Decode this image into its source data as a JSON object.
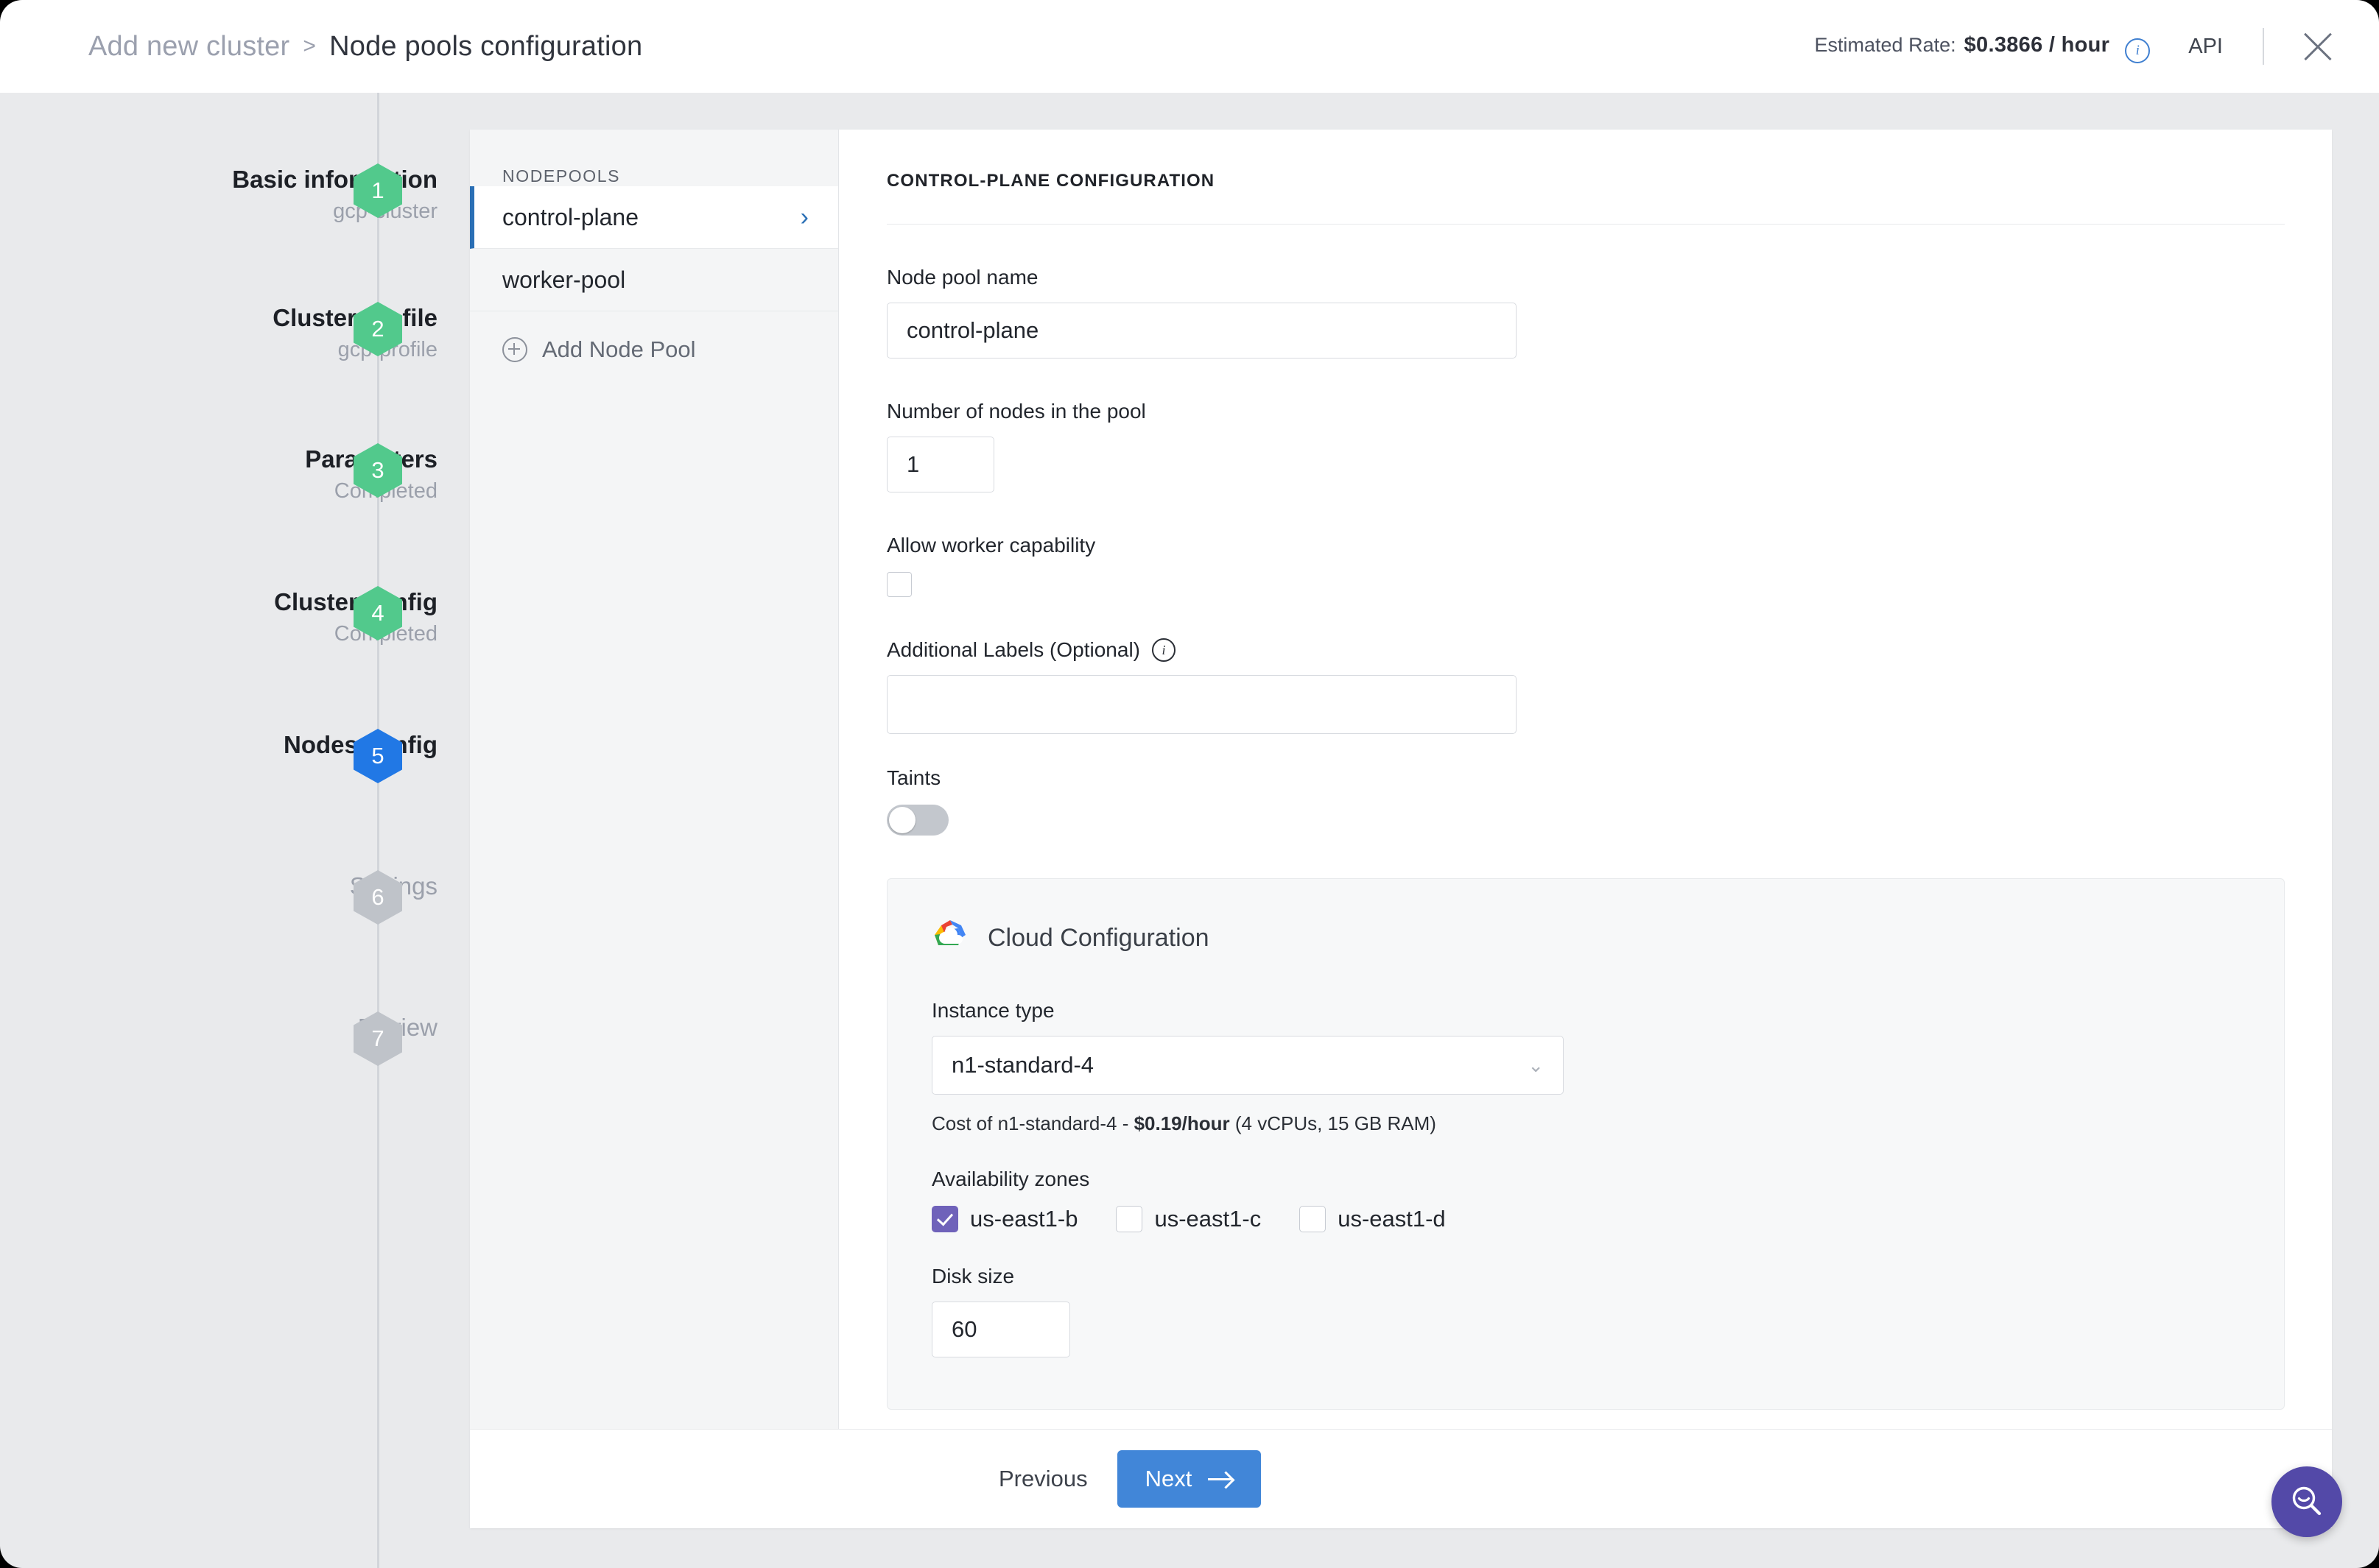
{
  "header": {
    "breadcrumb_parent": "Add new cluster",
    "breadcrumb_separator": ">",
    "breadcrumb_current": "Node pools configuration",
    "rate_label": "Estimated Rate:",
    "rate_value": "$0.3866 / hour",
    "rate_info_icon": "info-icon",
    "api_link": "API",
    "close_icon": "close-icon"
  },
  "stepper": {
    "steps": [
      {
        "num": "1",
        "title": "Basic information",
        "sub": "gcp-cluster",
        "state": "done"
      },
      {
        "num": "2",
        "title": "Cluster profile",
        "sub": "gcp-profile",
        "state": "done"
      },
      {
        "num": "3",
        "title": "Parameters",
        "sub": "Completed",
        "state": "done"
      },
      {
        "num": "4",
        "title": "Cluster config",
        "sub": "Completed",
        "state": "done"
      },
      {
        "num": "5",
        "title": "Nodes config",
        "sub": "",
        "state": "current"
      },
      {
        "num": "6",
        "title": "Settings",
        "sub": "",
        "state": "pending"
      },
      {
        "num": "7",
        "title": "Review",
        "sub": "",
        "state": "pending"
      }
    ]
  },
  "nodepools": {
    "panel_header": "NODEPOOLS",
    "items": [
      {
        "label": "control-plane",
        "selected": true,
        "chevron": "chevron-right-icon"
      },
      {
        "label": "worker-pool",
        "selected": false
      }
    ],
    "add_label": "Add Node Pool",
    "add_icon": "plus-circle-icon"
  },
  "form": {
    "section_title": "CONTROL-PLANE CONFIGURATION",
    "node_pool_name_label": "Node pool name",
    "node_pool_name_value": "control-plane",
    "node_count_label": "Number of nodes in the pool",
    "node_count_value": "1",
    "worker_capability_label": "Allow worker capability",
    "worker_capability_checked": false,
    "additional_labels_label": "Additional Labels (Optional)",
    "additional_labels_info_icon": "info-icon",
    "additional_labels_value": "",
    "taints_label": "Taints",
    "taints_enabled": false
  },
  "cloud": {
    "title": "Cloud Configuration",
    "logo_icon": "google-cloud-icon",
    "instance_type_label": "Instance type",
    "instance_type_value": "n1-standard-4",
    "instance_dropdown_icon": "chevron-down-icon",
    "cost_prefix": "Cost of n1-standard-4 - ",
    "cost_value": "$0.19/hour",
    "cost_suffix": " (4 vCPUs, 15 GB RAM)",
    "zones_label": "Availability zones",
    "zones": [
      {
        "label": "us-east1-b",
        "checked": true
      },
      {
        "label": "us-east1-c",
        "checked": false
      },
      {
        "label": "us-east1-d",
        "checked": false
      }
    ],
    "disk_size_label": "Disk size",
    "disk_size_value": "60"
  },
  "footer": {
    "previous_label": "Previous",
    "next_label": "Next",
    "next_arrow_icon": "arrow-right-icon"
  },
  "fab": {
    "icon": "search-icon"
  },
  "colors": {
    "accent_blue": "#2178e5",
    "done_green": "#52c98c",
    "pending_grey": "#bfc3c9",
    "checkbox_purple": "#6f62ba",
    "fab_purple": "#5349a8",
    "next_button_blue": "#4186d8"
  }
}
